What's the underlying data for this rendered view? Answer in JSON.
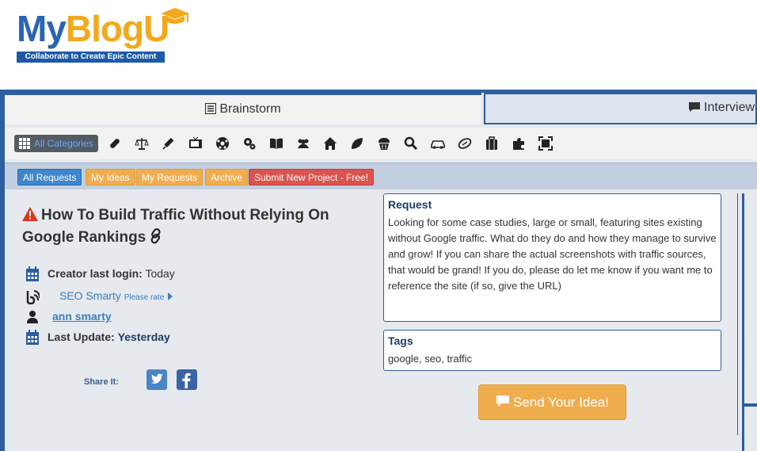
{
  "brand": {
    "logo_part1": "My",
    "logo_part2": "BlogU",
    "tagline": "Collaborate to Create Epic Content",
    "colors": {
      "blue": "#2a64b4",
      "orange": "#f2a91c",
      "navy": "#1d5aa8"
    }
  },
  "tabs": [
    {
      "label": "Brainstorm",
      "icon": "list-icon",
      "active": true
    },
    {
      "label": "Interviews",
      "icon": "comment-icon",
      "active": false
    }
  ],
  "categories": {
    "all_label": "All Categories",
    "icons": [
      "bandage-icon",
      "scales-icon",
      "syringe-icon",
      "tv-icon",
      "soccer-ball-icon",
      "gears-icon",
      "book-icon",
      "people-icon",
      "home-icon",
      "leaf-icon",
      "cupcake-icon",
      "search-icon",
      "car-icon",
      "football-icon",
      "luggage-icon",
      "puzzle-icon",
      "expand-icon"
    ]
  },
  "filters": [
    {
      "label": "All Requests",
      "style": "blue"
    },
    {
      "label": "My Ideas",
      "style": "orange"
    },
    {
      "label": "My Requests",
      "style": "orange"
    },
    {
      "label": "Archive",
      "style": "orange"
    },
    {
      "label": "Submit New Project - Free!",
      "style": "red"
    }
  ],
  "request": {
    "title": "How To Build Traffic Without Relying On Google Rankings",
    "creator_label": "Creator last login:",
    "creator_value": "Today",
    "site_name": "SEO Smarty",
    "rate_label": "Please rate",
    "user_name": "ann smarty",
    "update_label": "Last Update:",
    "update_value": "Yesterday",
    "share_label": "Share It:",
    "request_heading": "Request",
    "request_body": "Looking for some case studies, large or small, featuring sites existing without Google traffic. What do they do and how they manage to survive and grow! If you can share the actual screenshots with traffic sources, that would be grand! If you do, please do let me know if you want me to reference the site (if so, give the URL)",
    "tags_heading": "Tags",
    "tags_body": "google, seo, traffic",
    "send_label": "Send Your Idea!"
  }
}
